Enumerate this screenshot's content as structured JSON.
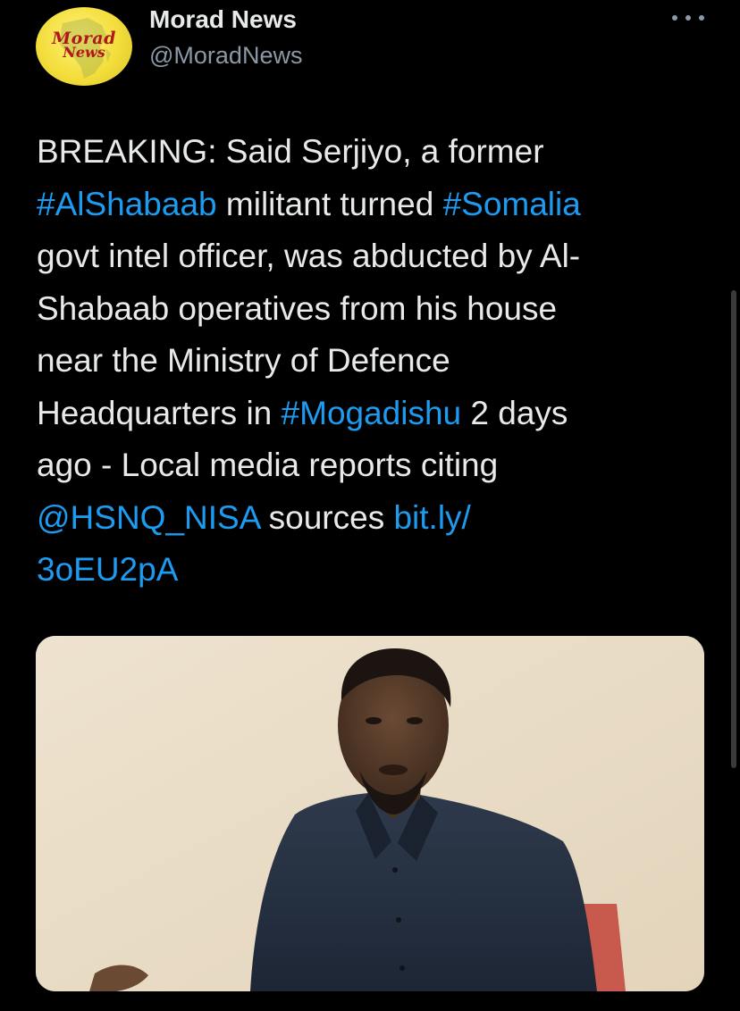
{
  "author": {
    "display_name": "Morad News",
    "handle": "@MoradNews",
    "avatar": {
      "line1": "Morad",
      "line2": "News",
      "background_color": "#f3de3c",
      "text_color": "#b01818"
    }
  },
  "more_icon": "more-horizontal-icon",
  "tweet": {
    "lines": [
      [
        {
          "text": "BREAKING: Said Serjiyo, a former",
          "link": false
        }
      ],
      [
        {
          "text": "#AlShabaab",
          "link": true
        },
        {
          "text": " militant turned ",
          "link": false
        },
        {
          "text": "#Somalia",
          "link": true
        }
      ],
      [
        {
          "text": "govt intel officer, was abducted by Al-",
          "link": false
        }
      ],
      [
        {
          "text": "Shabaab operatives from his house",
          "link": false
        }
      ],
      [
        {
          "text": "near the Ministry of Defence",
          "link": false
        }
      ],
      [
        {
          "text": "Headquarters in ",
          "link": false
        },
        {
          "text": "#Mogadishu",
          "link": true
        },
        {
          "text": " 2 days",
          "link": false
        }
      ],
      [
        {
          "text": "ago - Local media reports citing",
          "link": false
        }
      ],
      [
        {
          "text": "@HSNQ_NISA",
          "link": true
        },
        {
          "text": " sources ",
          "link": false
        },
        {
          "text": "bit.ly/",
          "link": true
        }
      ],
      [
        {
          "text": "3oEU2pA",
          "link": true
        }
      ]
    ]
  },
  "colors": {
    "background": "#000000",
    "text": "#e7e9ea",
    "secondary": "#8b98a5",
    "link": "#1d9bf0"
  },
  "media": {
    "type": "photo",
    "subject": "man-in-dark-shirt-photo"
  }
}
